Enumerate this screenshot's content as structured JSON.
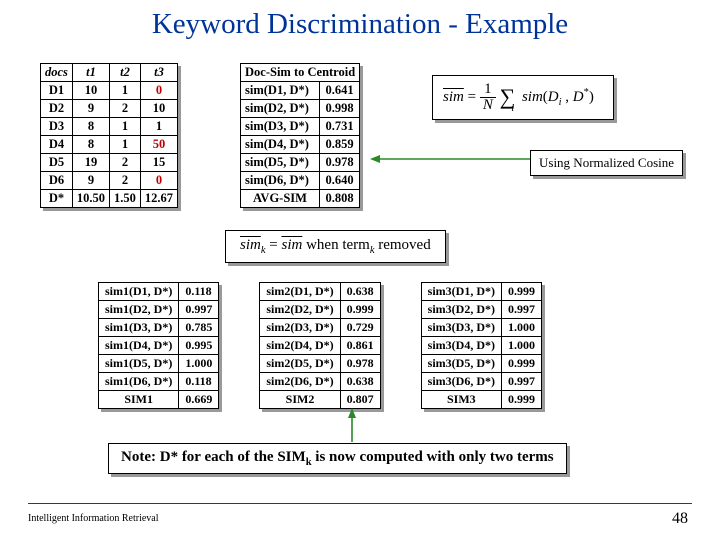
{
  "title": "Keyword Discrimination - Example",
  "docs_table": {
    "headers": [
      "docs",
      "t1",
      "t2",
      "t3"
    ],
    "rows": [
      [
        "D1",
        "10",
        "1",
        "0"
      ],
      [
        "D2",
        "9",
        "2",
        "10"
      ],
      [
        "D3",
        "8",
        "1",
        "1"
      ],
      [
        "D4",
        "8",
        "1",
        "50"
      ],
      [
        "D5",
        "19",
        "2",
        "15"
      ],
      [
        "D6",
        "9",
        "2",
        "0"
      ]
    ],
    "centroid": [
      "D*",
      "10.50",
      "1.50",
      "12.67"
    ]
  },
  "centroid_sim": {
    "header": "Doc-Sim to Centroid",
    "rows": [
      [
        "sim(D1, D*)",
        "0.641"
      ],
      [
        "sim(D2, D*)",
        "0.998"
      ],
      [
        "sim(D3, D*)",
        "0.731"
      ],
      [
        "sim(D4, D*)",
        "0.859"
      ],
      [
        "sim(D5, D*)",
        "0.978"
      ],
      [
        "sim(D6, D*)",
        "0.640"
      ]
    ],
    "avg": [
      "AVG-SIM",
      "0.808"
    ]
  },
  "formula1": {
    "text": "sim = (1/N) Σᵢ sim(Dᵢ, D*)"
  },
  "cosine_label": "Using Normalized Cosine",
  "formula2": {
    "text_left": "sim",
    "text_k": "k",
    "text_mid": " = ",
    "text_right": "sim",
    "text_cond": " when term",
    "text_k2": "k",
    "text_end": " removed"
  },
  "sim_tables": [
    {
      "label": "sim1",
      "rows": [
        [
          "sim1(D1, D*)",
          "0.118"
        ],
        [
          "sim1(D2, D*)",
          "0.997"
        ],
        [
          "sim1(D3, D*)",
          "0.785"
        ],
        [
          "sim1(D4, D*)",
          "0.995"
        ],
        [
          "sim1(D5, D*)",
          "1.000"
        ],
        [
          "sim1(D6, D*)",
          "0.118"
        ]
      ],
      "avg": [
        "SIM1",
        "0.669"
      ]
    },
    {
      "label": "sim2",
      "rows": [
        [
          "sim2(D1, D*)",
          "0.638"
        ],
        [
          "sim2(D2, D*)",
          "0.999"
        ],
        [
          "sim2(D3, D*)",
          "0.729"
        ],
        [
          "sim2(D4, D*)",
          "0.861"
        ],
        [
          "sim2(D5, D*)",
          "0.978"
        ],
        [
          "sim2(D6, D*)",
          "0.638"
        ]
      ],
      "avg": [
        "SIM2",
        "0.807"
      ]
    },
    {
      "label": "sim3",
      "rows": [
        [
          "sim3(D1, D*)",
          "0.999"
        ],
        [
          "sim3(D2, D*)",
          "0.997"
        ],
        [
          "sim3(D3, D*)",
          "1.000"
        ],
        [
          "sim3(D4, D*)",
          "1.000"
        ],
        [
          "sim3(D5, D*)",
          "0.999"
        ],
        [
          "sim3(D6, D*)",
          "0.997"
        ]
      ],
      "avg": [
        "SIM3",
        "0.999"
      ]
    }
  ],
  "note_text_a": "Note: D* for each of the SIM",
  "note_text_b": " is now computed with only two terms",
  "note_text_k": "k",
  "footer_left": "Intelligent Information Retrieval",
  "footer_right": "48",
  "chart_data": {
    "type": "table",
    "title": "Keyword Discrimination Example — document-term matrix, centroid similarities, and similarities with each term removed",
    "docs": [
      "D1",
      "D2",
      "D3",
      "D4",
      "D5",
      "D6"
    ],
    "terms": [
      "t1",
      "t2",
      "t3"
    ],
    "matrix": [
      [
        10,
        1,
        0
      ],
      [
        9,
        2,
        10
      ],
      [
        8,
        1,
        1
      ],
      [
        8,
        1,
        50
      ],
      [
        19,
        2,
        15
      ],
      [
        9,
        2,
        0
      ]
    ],
    "centroid": [
      10.5,
      1.5,
      12.67
    ],
    "sim_to_centroid": [
      0.641,
      0.998,
      0.731,
      0.859,
      0.978,
      0.64
    ],
    "avg_sim": 0.808,
    "sim_without_term": {
      "t1": {
        "values": [
          0.118,
          0.997,
          0.785,
          0.995,
          1.0,
          0.118
        ],
        "avg": 0.669
      },
      "t2": {
        "values": [
          0.638,
          0.999,
          0.729,
          0.861,
          0.978,
          0.638
        ],
        "avg": 0.807
      },
      "t3": {
        "values": [
          0.999,
          0.997,
          1.0,
          1.0,
          0.999,
          0.997
        ],
        "avg": 0.999
      }
    }
  }
}
